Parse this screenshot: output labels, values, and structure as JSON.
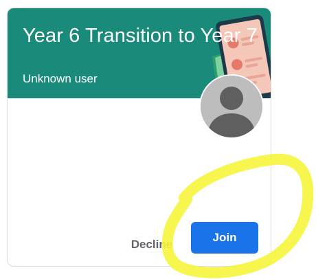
{
  "class_card": {
    "title": "Year 6 Transition to Year 7",
    "teacher": "Unknown user",
    "header_color": "#1a8a7b",
    "avatar_icon": "person-silhouette-icon",
    "illustration": "phone-illustration"
  },
  "actions": {
    "decline_label": "Decline",
    "join_label": "Join",
    "join_color": "#1a73e8"
  },
  "annotation": {
    "type": "yellow-freehand-circle",
    "color": "#f5f53b"
  }
}
